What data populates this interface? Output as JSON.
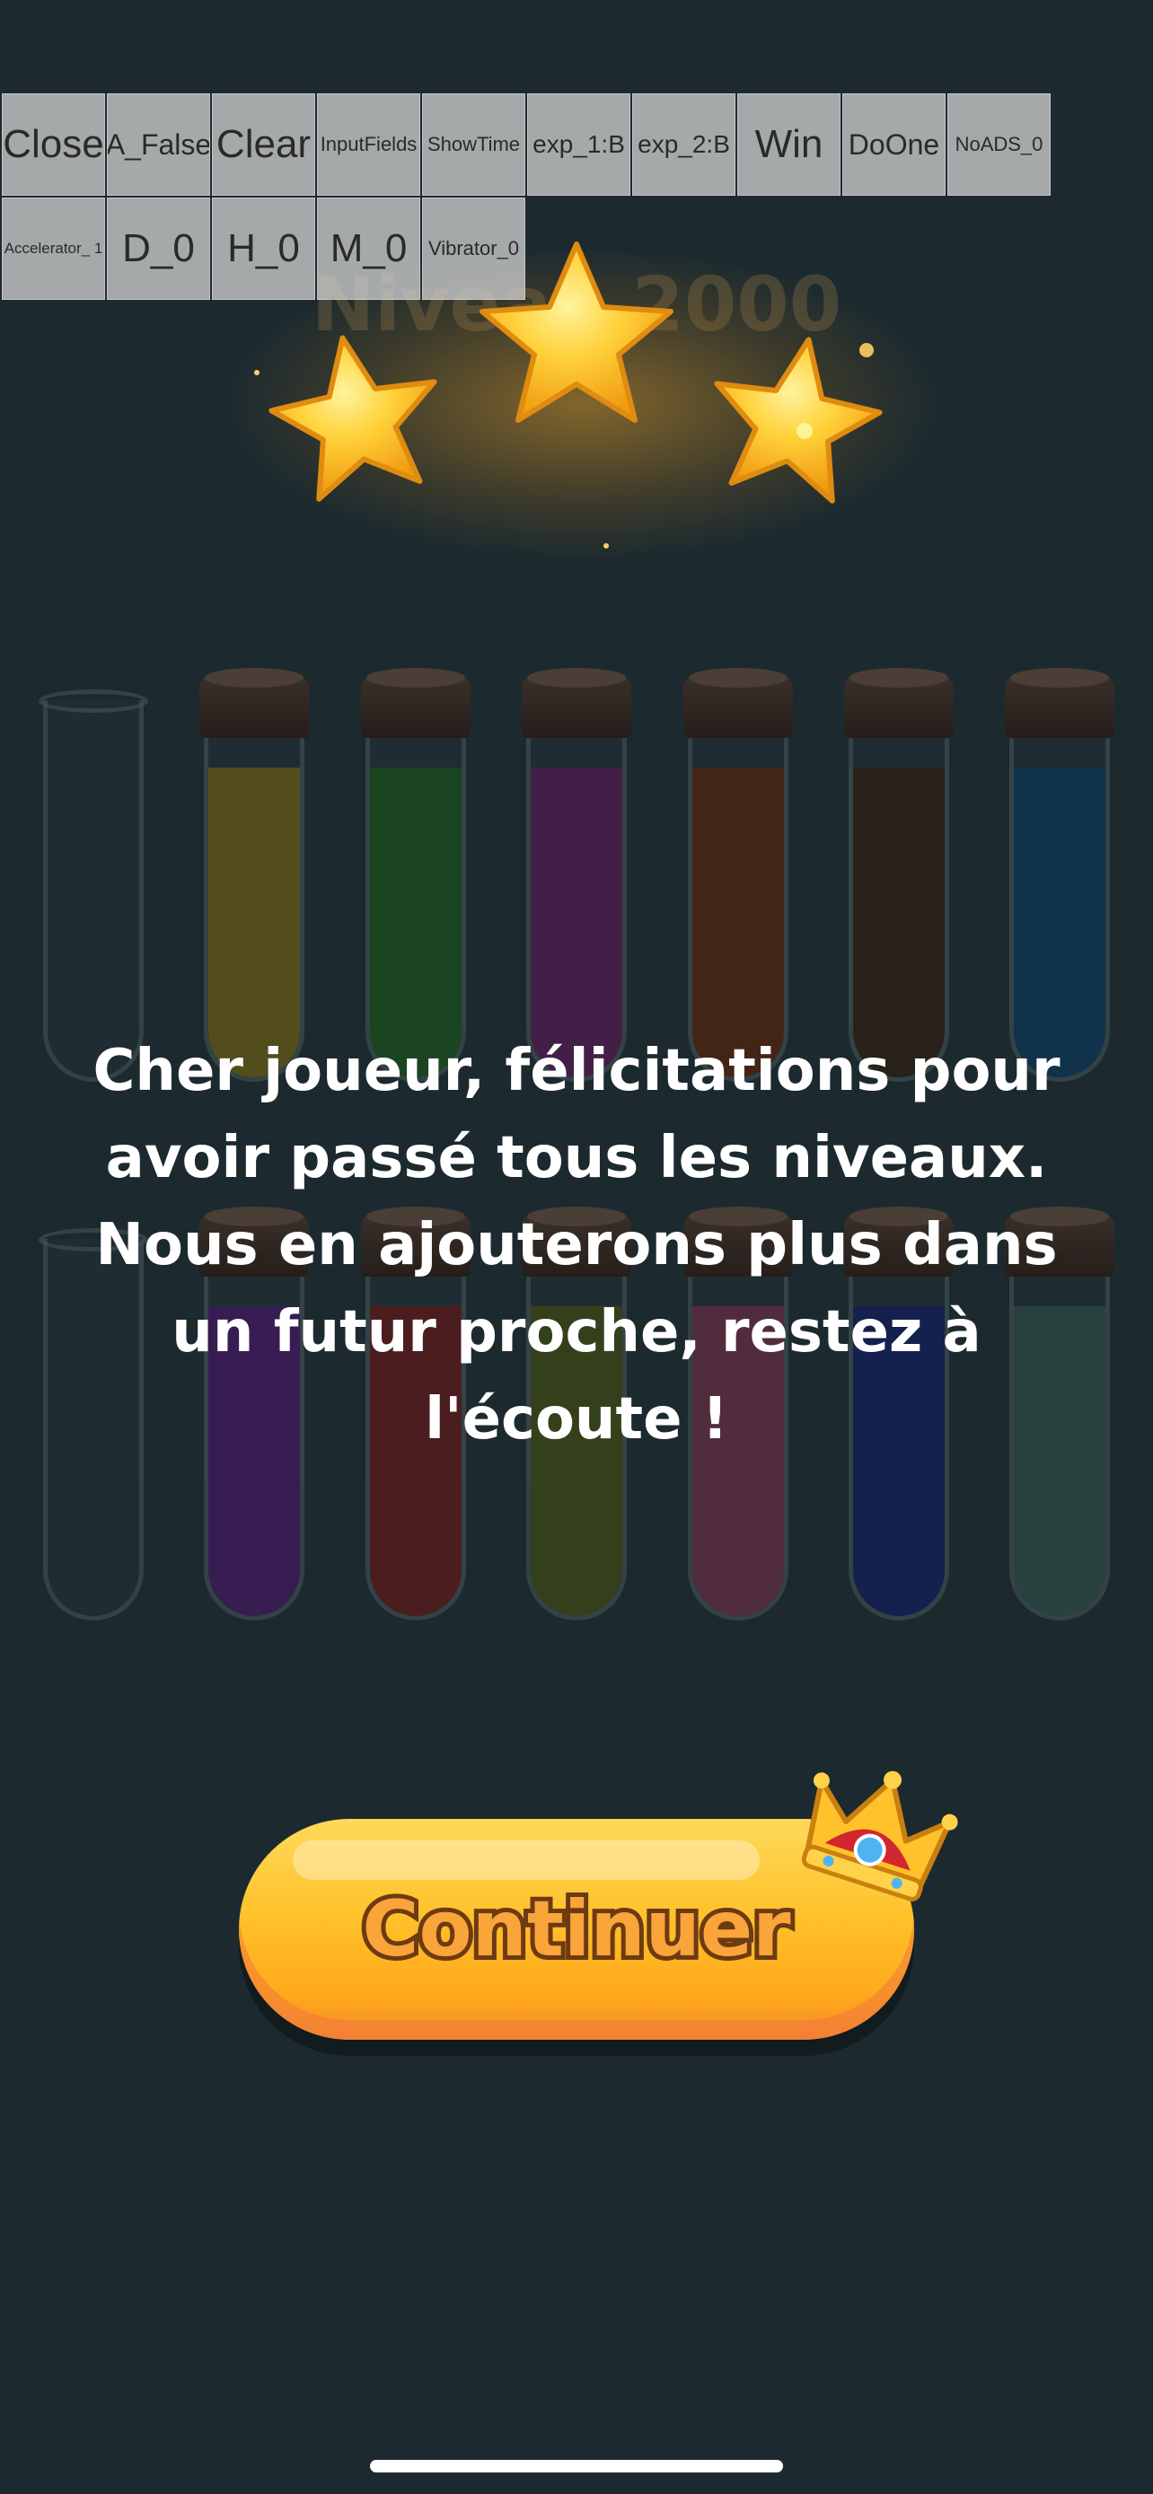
{
  "debug_buttons": [
    {
      "label": "Close",
      "size": "fs-xl"
    },
    {
      "label": "A_False",
      "size": "fs-l"
    },
    {
      "label": "Clear",
      "size": "fs-xl"
    },
    {
      "label": "InputFields",
      "size": "fs-s"
    },
    {
      "label": "ShowTime",
      "size": "fs-s"
    },
    {
      "label": "exp_1:B",
      "size": "fs-m"
    },
    {
      "label": "exp_2:B",
      "size": "fs-m"
    },
    {
      "label": "Win",
      "size": "fs-xl"
    },
    {
      "label": "DoOne",
      "size": "fs-l"
    },
    {
      "label": "NoADS_0",
      "size": "fs-s"
    },
    {
      "label": "Accelerator_ 1",
      "size": "fs-xs"
    },
    {
      "label": "D_0",
      "size": "fs-xl"
    },
    {
      "label": "H_0",
      "size": "fs-xl"
    },
    {
      "label": "M_0",
      "size": "fs-xl"
    },
    {
      "label": "Vibrator_0",
      "size": "fs-s"
    }
  ],
  "level_title": "Niveau 2000",
  "stars_earned": 3,
  "message": "Cher joueur, félicitations pour avoir passé tous les niveaux. Nous en ajouterons plus dans un futur proche, restez à l'écoute !",
  "continue_label": "Continuer",
  "colors": {
    "background": "#1c2a2f",
    "star": "#ffc52b",
    "button": "#ffc12a",
    "button_text_outline": "#6e3a12"
  },
  "tubes_row1": [
    {
      "cork": false,
      "liquids": []
    },
    {
      "cork": true,
      "liquids": [
        "#5c5418"
      ]
    },
    {
      "cork": true,
      "liquids": [
        "#1b4a1f"
      ]
    },
    {
      "cork": true,
      "liquids": [
        "#4a1d4c"
      ]
    },
    {
      "cork": true,
      "liquids": [
        "#4a2410"
      ]
    },
    {
      "cork": true,
      "liquids": [
        "#2a2116"
      ]
    },
    {
      "cork": true,
      "liquids": [
        "#0f3450"
      ]
    }
  ],
  "tubes_row2": [
    {
      "cork": false,
      "liquids": []
    },
    {
      "cork": true,
      "liquids": [
        "#3c1b58"
      ]
    },
    {
      "cork": true,
      "liquids": [
        "#541b1b"
      ]
    },
    {
      "cork": true,
      "liquids": [
        "#384418"
      ]
    },
    {
      "cork": true,
      "liquids": [
        "#5a2d40"
      ]
    },
    {
      "cork": true,
      "liquids": [
        "#131e52"
      ]
    },
    {
      "cork": true,
      "liquids": [
        "#2d4640"
      ]
    }
  ]
}
